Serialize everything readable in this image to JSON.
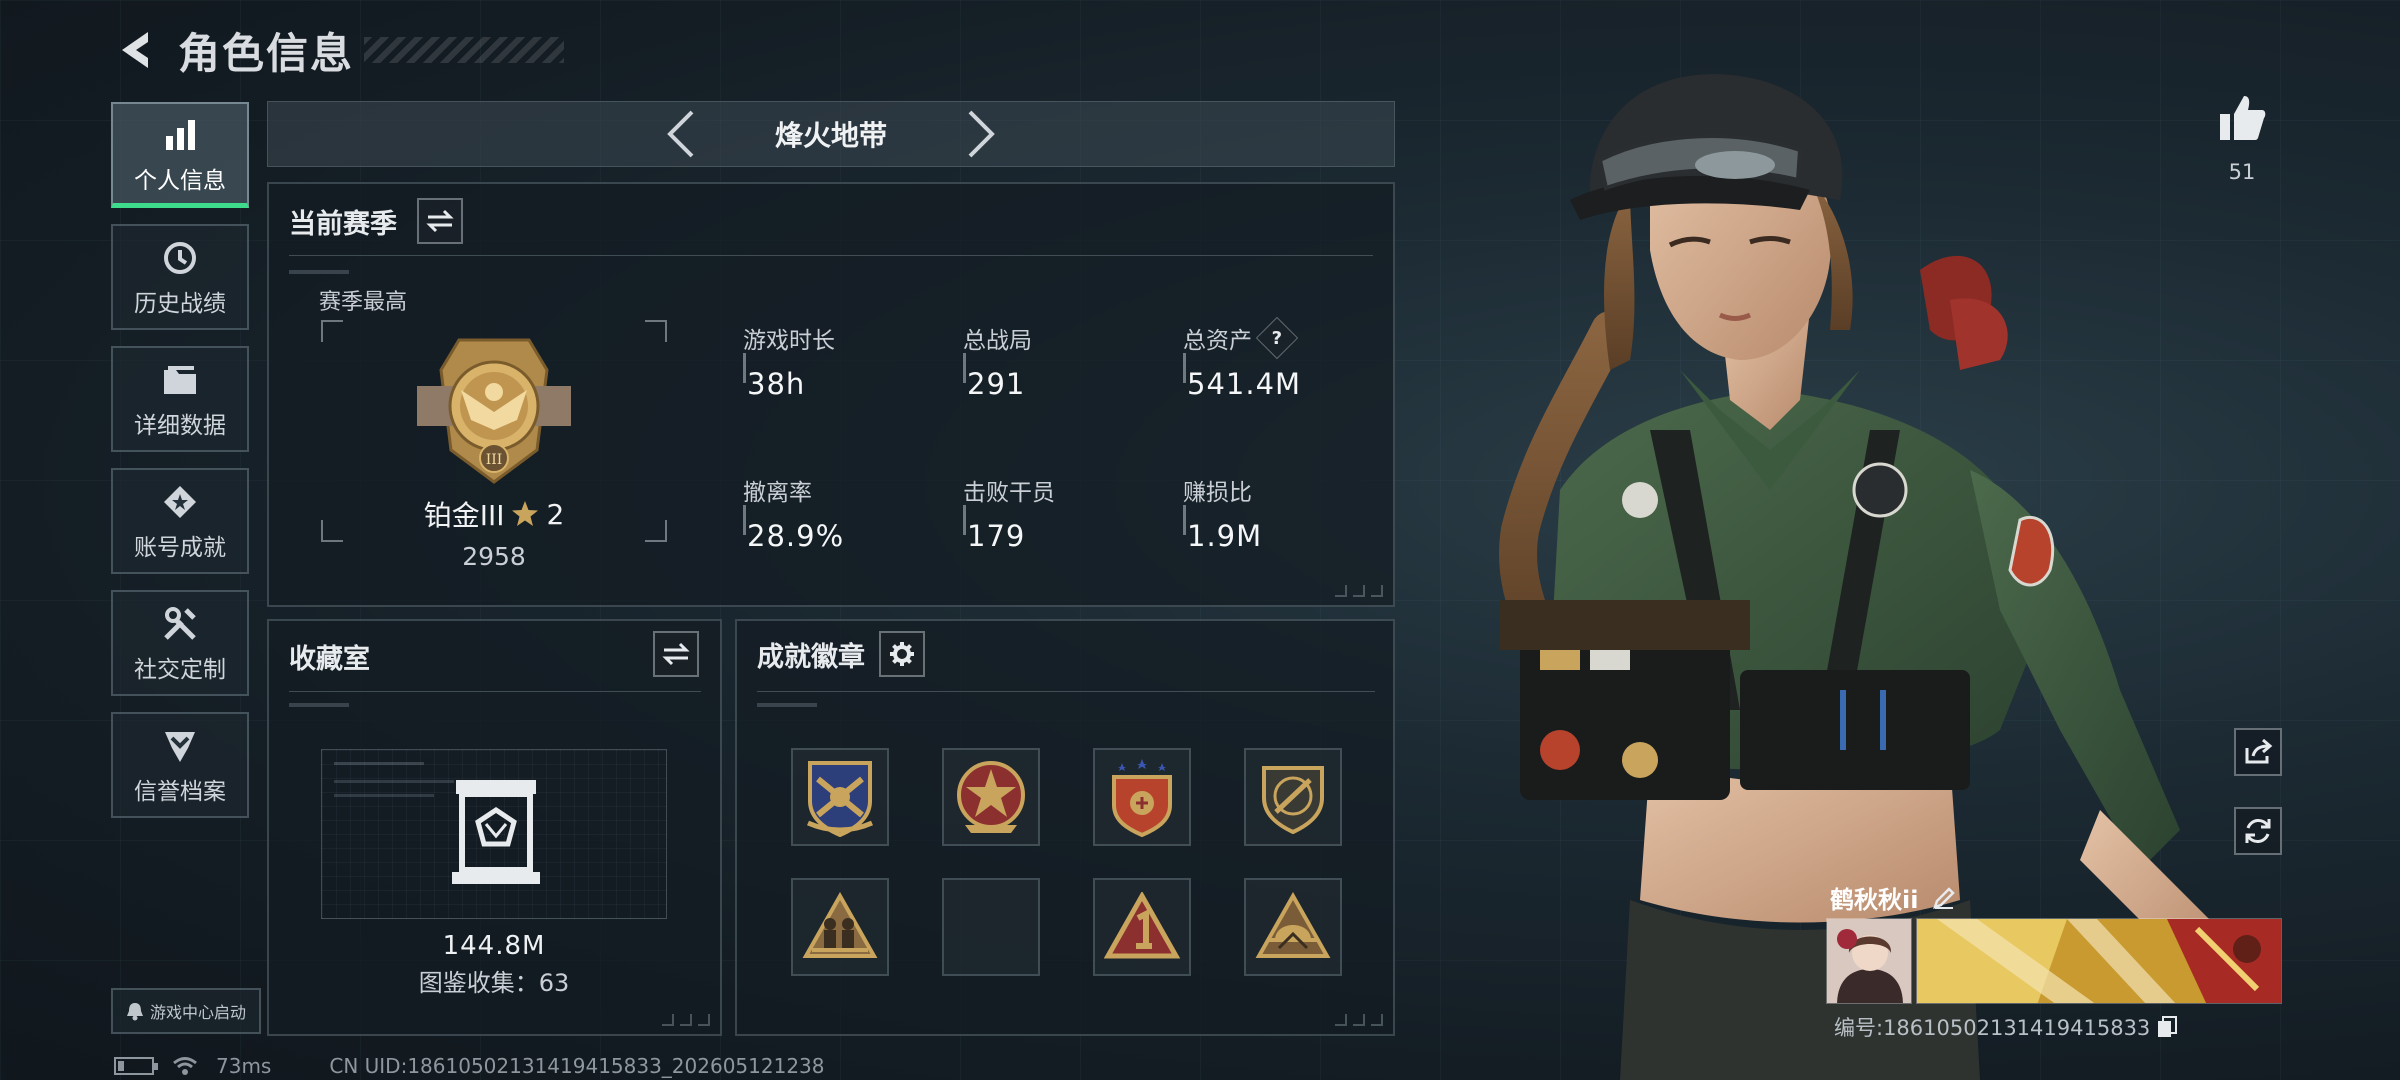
{
  "header": {
    "title": "角色信息"
  },
  "sidebar": {
    "items": [
      {
        "label": "个人信息",
        "icon": "bar-chart-icon",
        "active": true
      },
      {
        "label": "历史战绩",
        "icon": "history-clock-icon"
      },
      {
        "label": "详细数据",
        "icon": "folder-icon"
      },
      {
        "label": "账号成就",
        "icon": "achievement-star-icon"
      },
      {
        "label": "社交定制",
        "icon": "wrench-tools-icon"
      },
      {
        "label": "信誉档案",
        "icon": "shield-chevron-icon"
      }
    ],
    "launch_label": "游戏中心启动"
  },
  "mode": {
    "title": "烽火地带"
  },
  "season": {
    "title": "当前赛季",
    "best_label": "赛季最高",
    "rank_name": "铂金III",
    "rank_stars": "2",
    "rank_score": "2958",
    "stats": [
      {
        "label": "游戏时长",
        "value": "38h"
      },
      {
        "label": "总战局",
        "value": "291"
      },
      {
        "label": "总资产",
        "value": "541.4M",
        "help": "?"
      },
      {
        "label": "撤离率",
        "value": "28.9%"
      },
      {
        "label": "击败干员",
        "value": "179"
      },
      {
        "label": "赚损比",
        "value": "1.9M"
      }
    ]
  },
  "collection": {
    "title": "收藏室",
    "value": "144.8M",
    "count_text": "图鉴收集：63"
  },
  "badges": {
    "title": "成就徽章",
    "slots": [
      {
        "icon": "crossed-rifles-badge-icon",
        "filled": true
      },
      {
        "icon": "red-star-badge-icon",
        "filled": true
      },
      {
        "icon": "three-stars-badge-icon",
        "filled": true
      },
      {
        "icon": "rifle-shield-badge-icon",
        "filled": true
      },
      {
        "icon": "soldiers-triangle-badge-icon",
        "filled": true
      },
      {
        "icon": "empty-slot",
        "filled": false
      },
      {
        "icon": "number-one-triangle-badge-icon",
        "filled": true
      },
      {
        "icon": "helmet-triangle-badge-icon",
        "filled": true
      }
    ]
  },
  "status": {
    "ping": "73ms",
    "uid": "CN UID:1861050213141941583​3_202605121238"
  },
  "profile": {
    "likes": "51",
    "name": "鹤秋秋ii",
    "id_text": "编号:1861050213141941583​3"
  },
  "colors": {
    "accent": "#3ddb8b",
    "gold": "#c9a45c"
  }
}
